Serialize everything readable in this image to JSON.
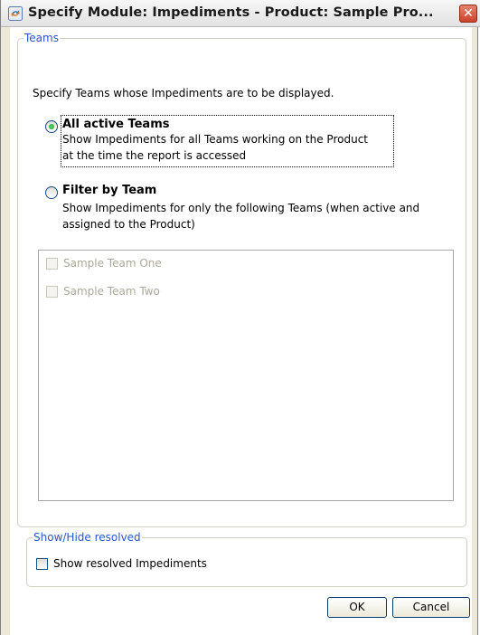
{
  "window": {
    "title": "Specify Module: Impediments - Product: Sample Pro...",
    "close_glyph": "✕",
    "icons": {
      "app": "app-icon",
      "close": "close-icon"
    }
  },
  "teams_group": {
    "legend": "Teams",
    "instruction": "Specify Teams whose Impediments are to be displayed.",
    "options": [
      {
        "label": "All active Teams",
        "description_line1": "Show Impediments for all Teams working on the Product",
        "description_line2": "at the time the report is accessed",
        "selected": true
      },
      {
        "label": "Filter by Team",
        "description_line1": "Show Impediments for only the following Teams (when active and",
        "description_line2": "assigned to the Product)",
        "selected": false
      }
    ],
    "teams": [
      {
        "name": "Sample Team One",
        "checked": false,
        "enabled": false
      },
      {
        "name": "Sample Team Two",
        "checked": false,
        "enabled": false
      }
    ]
  },
  "resolved_group": {
    "legend": "Show/Hide resolved",
    "checkbox_label": "Show resolved Impediments",
    "checked": false
  },
  "buttons": {
    "ok": "OK",
    "cancel": "Cancel"
  },
  "colors": {
    "legend": "#2956c8",
    "disabled_text": "#aca899",
    "group_border": "#d0d0bf"
  }
}
